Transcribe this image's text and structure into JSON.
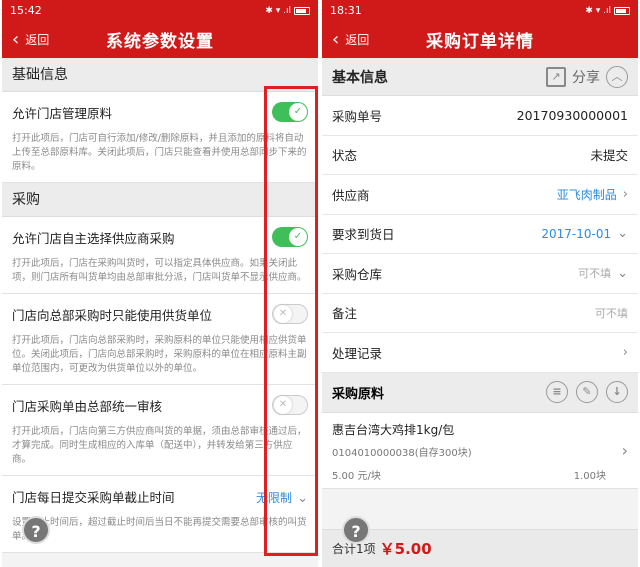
{
  "left": {
    "status": {
      "time": "15:42",
      "icons": "✱ ▾ .ıl"
    },
    "nav": {
      "back_label": "返回",
      "title": "系统参数设置"
    },
    "sections": [
      {
        "title": "基础信息"
      },
      {
        "title": "采购"
      }
    ],
    "settings": [
      {
        "label": "允许门店管理原料",
        "state": "on",
        "desc": "打开此项后，门店可自行添加/修改/删除原料，并且添加的原料将自动上传至总部原料库。关闭此项后，门店只能查看并使用总部同步下来的原料。"
      },
      {
        "label": "允许门店自主选择供应商采购",
        "state": "on",
        "desc": "打开此项后，门店在采购叫货时，可以指定具体供应商。如果关闭此项，则门店所有叫货单均由总部审批分派，门店叫货单不显示供应商。"
      },
      {
        "label": "门店向总部采购时只能使用供货单位",
        "state": "off",
        "desc": "打开此项后，门店向总部采购时，采购原料的单位只能使用相应供货单位。关闭此项后，门店向总部采购时，采购原料的单位在相应原料主副单位范围内，可更改为供货单位以外的单位。"
      },
      {
        "label": "门店采购单由总部统一审核",
        "state": "off",
        "desc": "打开此项后，门店向第三方供应商叫货的单据，须由总部审核通过后，才算完成。同时生成相应的入库单（配送中），并转发给第三方供应商。"
      },
      {
        "label": "门店每日提交采购单截止时间",
        "value": "无限制",
        "desc": "设置截止时间后，超过截止时间后当日不能再提交需要总部审核的叫货单。"
      }
    ],
    "help_label": "?"
  },
  "right": {
    "status": {
      "time": "18:31",
      "icons": "✱ ▾ .ıl"
    },
    "nav": {
      "back_label": "返回",
      "title": "采购订单详情"
    },
    "basic": {
      "title": "基本信息",
      "share_label": "分享"
    },
    "rows": [
      {
        "label": "采购单号",
        "value": "20170930000001"
      },
      {
        "label": "状态",
        "value": "未提交"
      },
      {
        "label": "供应商",
        "value": "亚飞肉制品"
      },
      {
        "label": "要求到货日",
        "value": "2017-10-01"
      },
      {
        "label": "采购仓库",
        "value": "可不填"
      },
      {
        "label": "备注",
        "value": "可不填"
      },
      {
        "label": "处理记录",
        "value": ""
      }
    ],
    "materials": {
      "title": "采购原料",
      "items": [
        {
          "name": "惠吉台湾大鸡排1kg/包",
          "code": "0104010000038(自存300块)",
          "price": "5.00 元/块",
          "qty": "1.00块"
        }
      ]
    },
    "footer": {
      "total_label": "合计1项",
      "total": "￥5.00"
    },
    "help_label": "?"
  },
  "colors": {
    "brand_red": "#d01a1a",
    "toggle_green": "#3fbf5a",
    "link_blue": "#2d8ce0"
  },
  "icons": [
    "chevron-left-icon",
    "share-icon",
    "chevron-up-icon",
    "list-icon",
    "edit-icon",
    "download-icon",
    "chevron-right-icon",
    "chevron-down-icon",
    "check-icon",
    "cross-icon",
    "help-icon"
  ]
}
